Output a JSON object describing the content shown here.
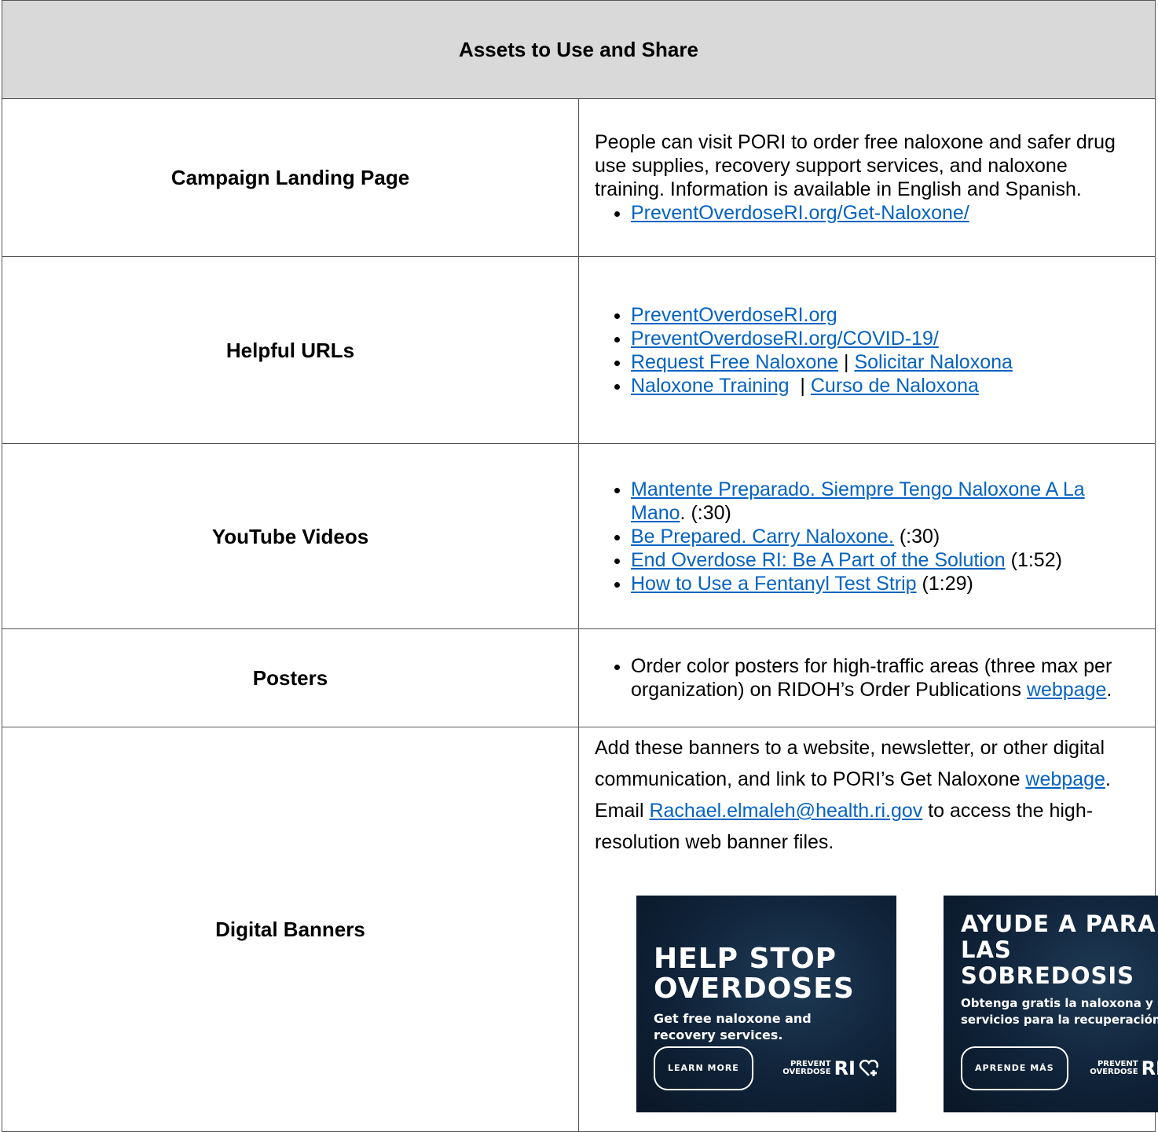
{
  "table": {
    "title": "Assets to Use and Share",
    "rows": {
      "landing": {
        "label": "Campaign Landing Page",
        "text": "People can visit PORI to order free naloxone and safer drug use supplies, recovery support services, and naloxone training. Information is available in English and Spanish.",
        "link": "PreventOverdoseRI.org/Get-Naloxone/"
      },
      "urls": {
        "label": "Helpful URLs",
        "link1": "PreventOverdoseRI.org",
        "link2": "PreventOverdoseRI.org/COVID-19/",
        "link3a": "Request Free Naloxone",
        "sep": " | ",
        "link3b": "Solicitar Naloxona",
        "link4a": "Naloxone Training",
        "sep2": "  | ",
        "link4b": "Curso de Naloxona"
      },
      "videos": {
        "label": "YouTube Videos",
        "items": [
          {
            "title": "Mantente Preparado. Siempre Tengo Naloxone A La Mano",
            "suffix": ". (:30)"
          },
          {
            "title": "Be Prepared. Carry Naloxone.",
            "suffix": " (:30)"
          },
          {
            "title": "End Overdose RI: Be A Part of the Solution",
            "suffix": " (1:52)"
          },
          {
            "title": "How to Use a Fentanyl Test Strip",
            "suffix": " (1:29)"
          }
        ]
      },
      "posters": {
        "label": "Posters",
        "text": "Order color posters for high-traffic areas (three max per organization) on RIDOH’s Order Publications ",
        "link": "webpage",
        "end": "."
      },
      "banners": {
        "label": "Digital Banners",
        "text1": "Add these banners to a website, newsletter, or other digital communication, and link to PORI’s Get Naloxone ",
        "link1": "webpage",
        "text2": ". Email ",
        "link2": "Rachael.elmaleh@health.ri.gov",
        "text3": " to access the high-resolution web banner files.",
        "banner_en": {
          "line1": "HELP STOP",
          "line2": "OVERDOSES",
          "sub1": "Get free naloxone and",
          "sub2": "recovery services.",
          "button": "LEARN MORE",
          "logo_top": "PREVENT",
          "logo_bottom": "OVERDOSE",
          "logo_ri": "RI"
        },
        "banner_es": {
          "line1": "AYUDE A PARAR",
          "line2": "LAS SOBREDOSIS",
          "sub1": "Obtenga gratis la naloxona y",
          "sub2": "servicios para la recuperación.",
          "button": "APRENDE MÁS",
          "logo_top": "PREVENT",
          "logo_bottom": "OVERDOSE",
          "logo_ri": "RI"
        }
      }
    }
  }
}
